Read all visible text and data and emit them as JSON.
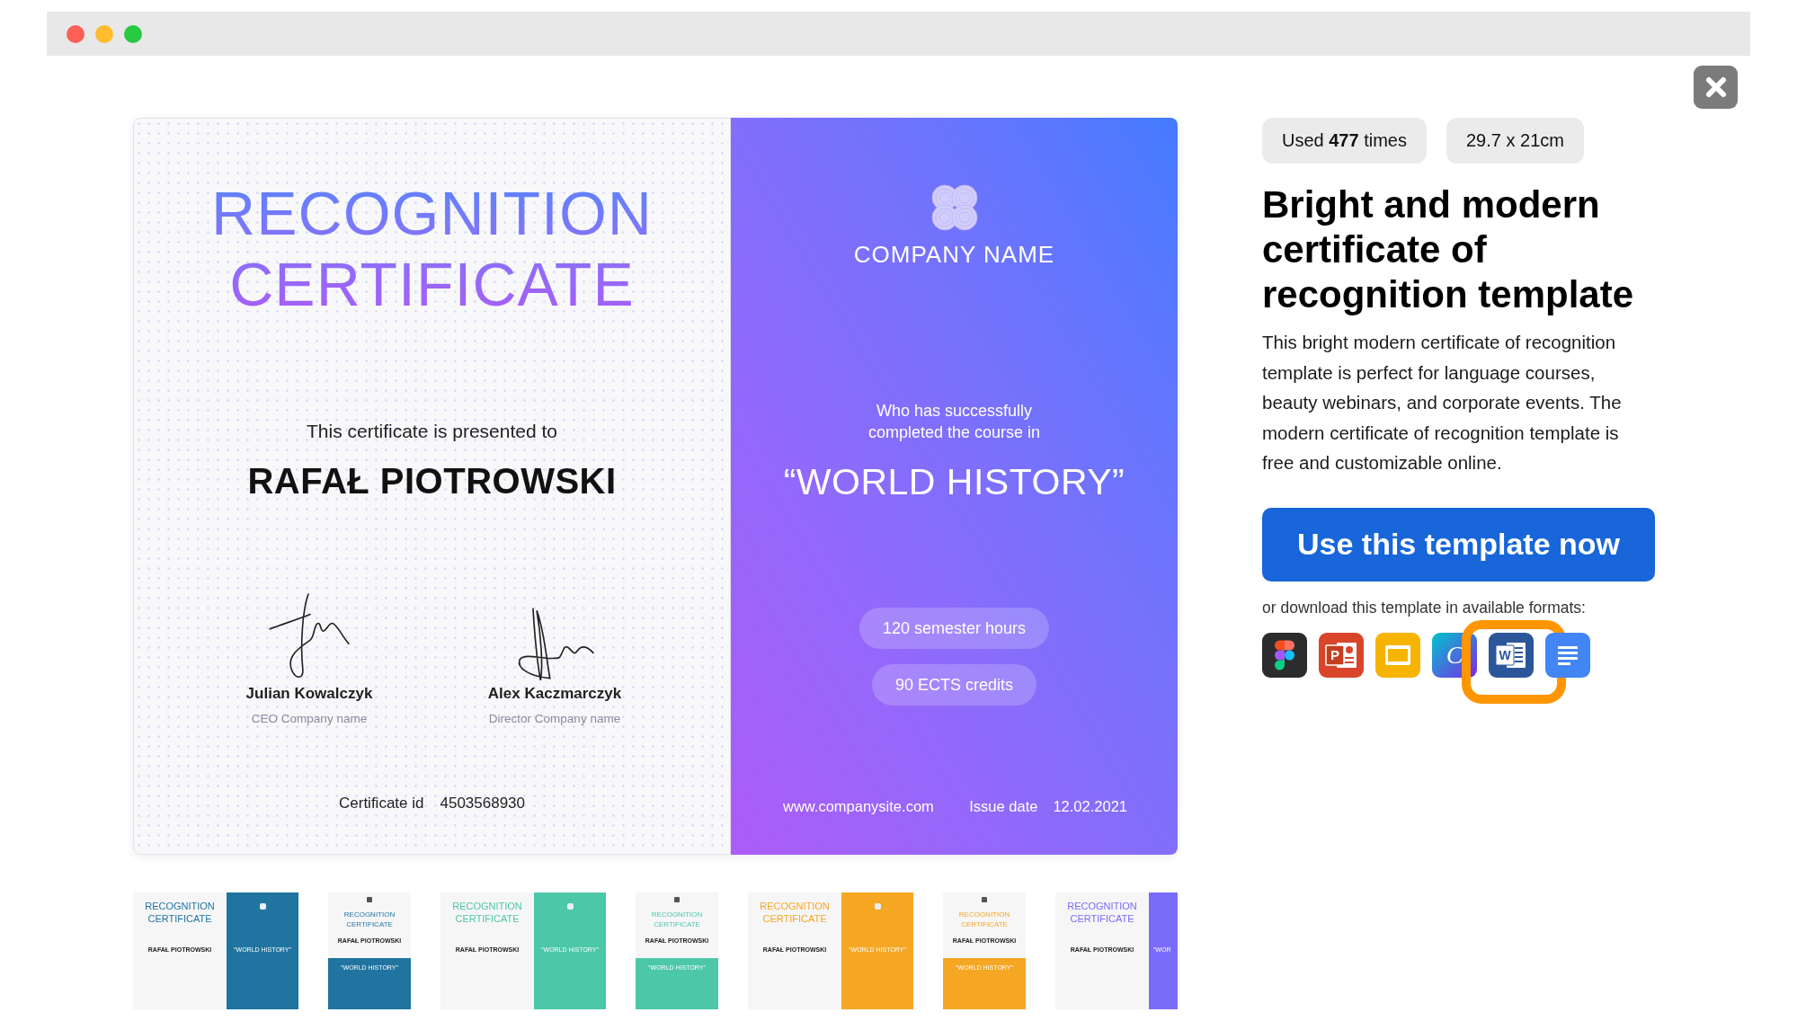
{
  "window": {
    "controls": [
      {
        "color": "#fe5f57"
      },
      {
        "color": "#febc2e"
      },
      {
        "color": "#28c840"
      }
    ]
  },
  "certificate": {
    "title": "RECOGNITION CERTIFICATE",
    "presented_to": "This certificate is presented to",
    "recipient": "RAFAŁ PIOTROWSKI",
    "signatories": [
      {
        "name": "Julian Kowalczyk",
        "role": "CEO Company name"
      },
      {
        "name": "Alex Kaczmarczyk",
        "role": "Director Company name"
      }
    ],
    "certificate_id_label": "Certificate id",
    "certificate_id": "4503568930",
    "company": "COMPANY NAME",
    "completion_text": "Who has successfully completed the course in",
    "course": "“WORLD HISTORY”",
    "badges": [
      "120 semester hours",
      "90 ECTS credits"
    ],
    "website": "www.companysite.com",
    "issue_date_label": "Issue date",
    "issue_date": "12.02.2021"
  },
  "thumbnails": [
    {
      "kind": "landscape",
      "color": "#1f74a0",
      "title": "RECOGNITION CERTIFICATE",
      "recipient": "RAFAŁ PIOTROWSKI",
      "course": "“WORLD HISTORY”"
    },
    {
      "kind": "portrait",
      "color": "#1f74a0",
      "title": "RECOGNITION CERTIFICATE",
      "recipient": "RAFAŁ PIOTROWSKI",
      "course": "“WORLD HISTORY”"
    },
    {
      "kind": "landscape",
      "color": "#4cc7a8",
      "title": "RECOGNITION CERTIFICATE",
      "recipient": "RAFAŁ PIOTROWSKI",
      "course": "“WORLD HISTORY”"
    },
    {
      "kind": "portrait",
      "color": "#4cc7a8",
      "title": "RECOGNITION CERTIFICATE",
      "recipient": "RAFAŁ PIOTROWSKI",
      "course": "“WORLD HISTORY”"
    },
    {
      "kind": "landscape",
      "color": "#f5a623",
      "title": "RECOGNITION CERTIFICATE",
      "recipient": "RAFAŁ PIOTROWSKI",
      "course": "“WORLD HISTORY”"
    },
    {
      "kind": "portrait",
      "color": "#f5a623",
      "title": "RECOGNITION CERTIFICATE",
      "recipient": "RAFAŁ PIOTROWSKI",
      "course": "“WORLD HISTORY”"
    },
    {
      "kind": "landscape",
      "color": "#7a6cfb",
      "title": "RECOGNITION CERTIFICATE",
      "recipient": "RAFAŁ PIOTROWSKI",
      "course": "“WOR"
    }
  ],
  "details": {
    "badges": [
      "Used **477** times",
      "29.7 x 21cm"
    ],
    "title": "Bright and modern certificate of recognition template",
    "description": "This bright modern certificate of recognition template is perfect for language courses, beauty webinars, and corporate events. The modern certificate of recognition template is free and customizable online.",
    "cta": "Use this template now",
    "download_hint": "or download this template in available formats:",
    "formats": [
      {
        "kind": "shapes",
        "highlighted": false
      },
      {
        "kind": "presentation",
        "glyph": "P",
        "highlighted": false
      },
      {
        "kind": "slides",
        "highlighted": false
      },
      {
        "kind": "curve",
        "glyph": "C",
        "highlighted": false
      },
      {
        "kind": "document",
        "glyph": "W",
        "highlighted": true
      },
      {
        "kind": "text_document",
        "highlighted": false
      }
    ]
  }
}
